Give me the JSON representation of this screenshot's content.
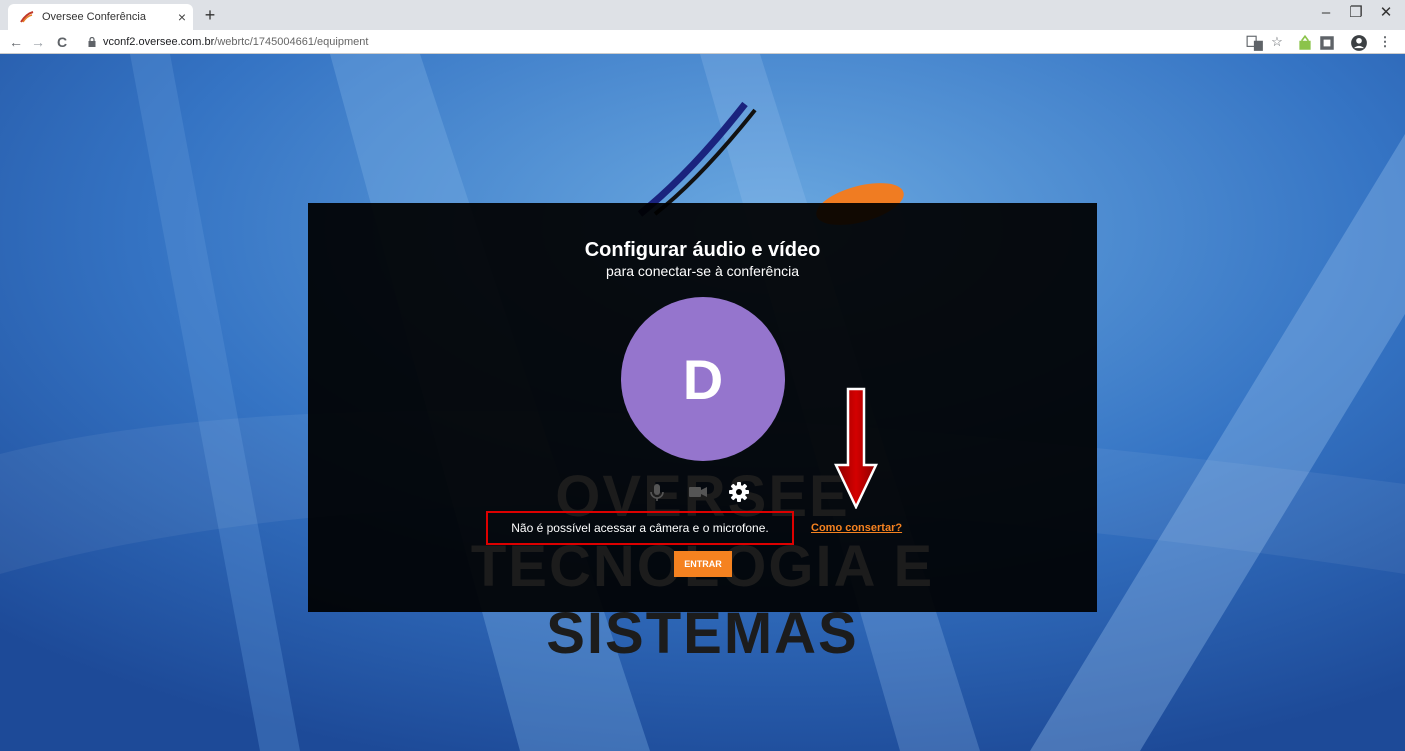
{
  "browser": {
    "tab_title": "Oversee Conferência",
    "tab_close": "×",
    "new_tab": "+",
    "url_host": "vconf2.oversee.com.br",
    "url_path": "/webrtc/1745004661/equipment",
    "window_controls": {
      "minimize": "–",
      "restore": "❐",
      "close": "✕"
    },
    "nav": {
      "back": "←",
      "forward": "→",
      "reload": "C"
    }
  },
  "dialog": {
    "title": "Configurar áudio e vídeo",
    "subtitle": "para conectar-se à conferência",
    "avatar_letter": "D",
    "watermark_line1": "OVERSEE",
    "watermark_line2": "TECNOLOGIA E SISTEMAS",
    "error_message": "Não é possível acessar a câmera e o microfone.",
    "fix_link": "Como consertar?",
    "enter_button": "ENTRAR",
    "icons": [
      "microphone-icon",
      "camera-icon",
      "gear-icon"
    ]
  },
  "colors": {
    "accent": "#f58220",
    "avatar": "#9575cd",
    "annotation": "#cc0000",
    "panel": "#000000"
  }
}
